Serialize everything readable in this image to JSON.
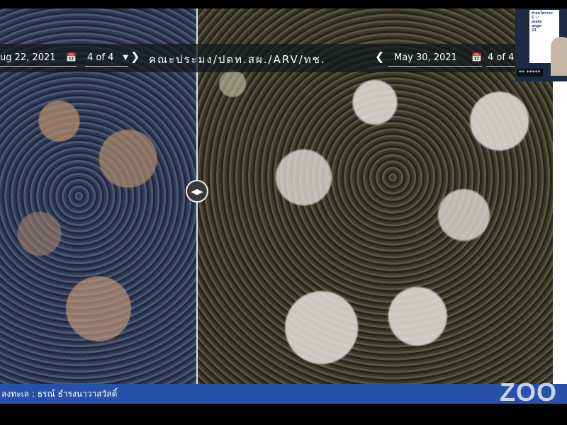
{
  "viewer": {
    "left_date": "ug 22, 2021",
    "left_page": "4 of 4",
    "center_title": "คณะประมง/ปดท.สผ./ARV/ทช.",
    "right_date": "May 30, 2021",
    "right_page": "4 of 4"
  },
  "icons": {
    "calendar": "📅",
    "caret_down": "▼",
    "chevron_right": "❯",
    "chevron_left": "❮",
    "swipe": "◀▶"
  },
  "video_tile": {
    "slide_text": "ฝ่ายนวัตกรรม\nC ☉\nmate\nange\n21",
    "name_label": "** *****"
  },
  "footer": {
    "credit": "ลงทะเล : ธรณ์ ธำรงนาวาสวัสดิ์"
  },
  "zoom_logo": "ZOO"
}
